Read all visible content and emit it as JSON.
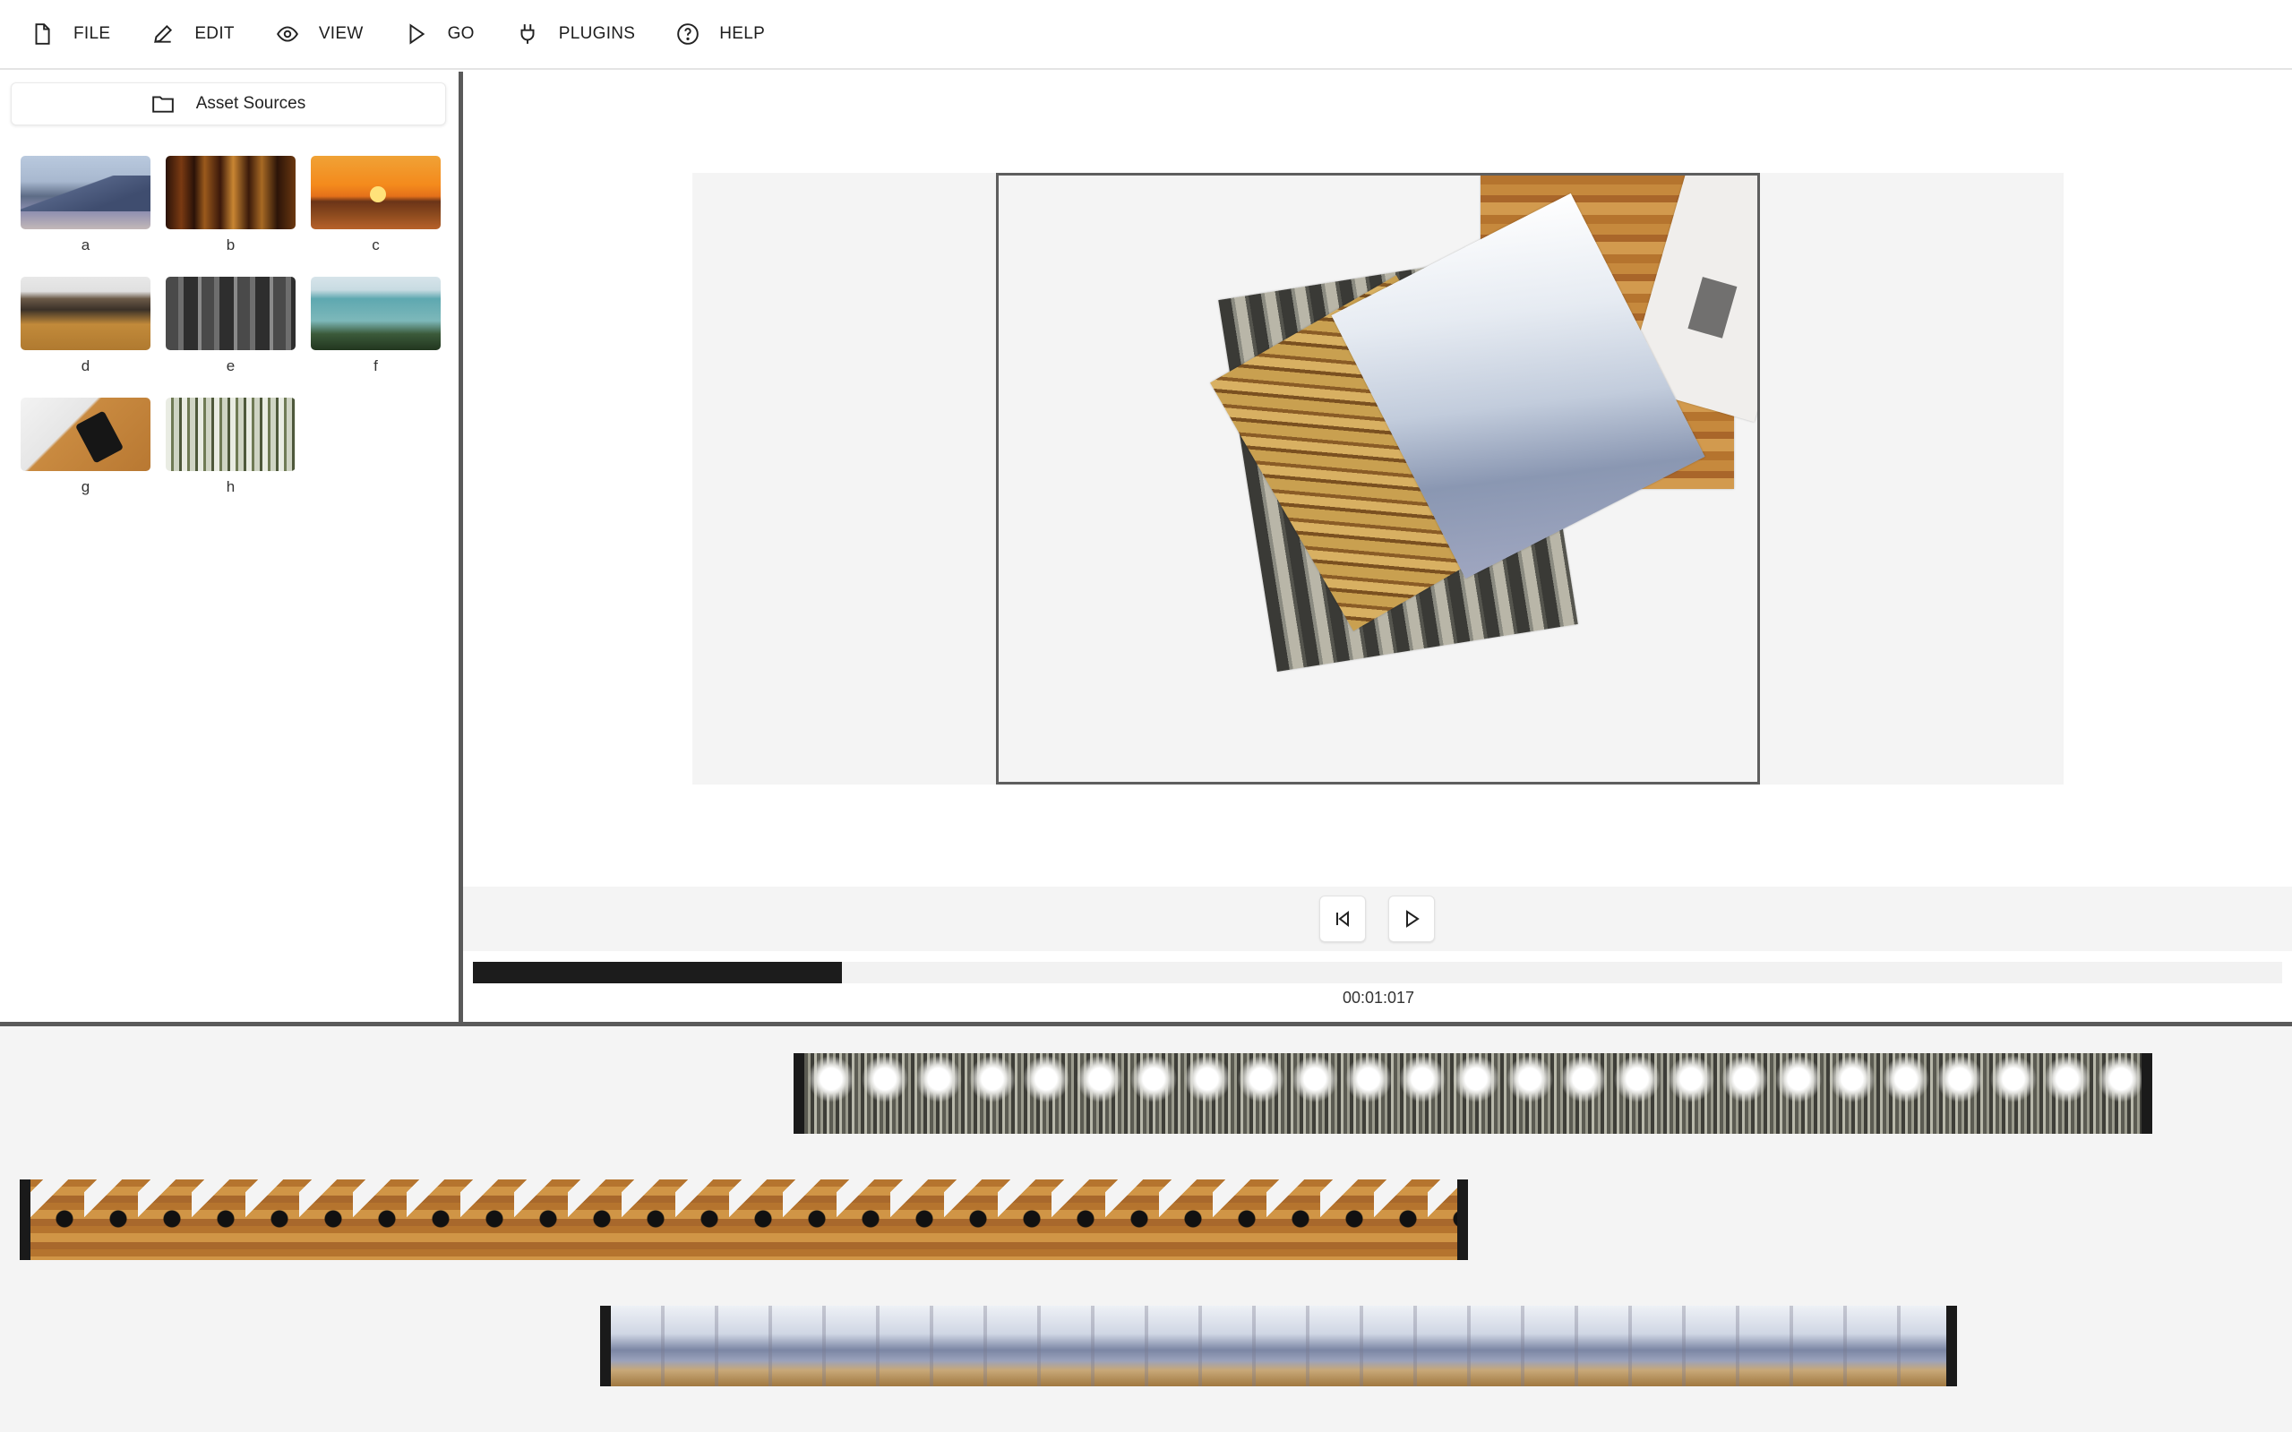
{
  "menu": [
    {
      "label": "FILE",
      "icon": "file-icon"
    },
    {
      "label": "EDIT",
      "icon": "pencil-icon"
    },
    {
      "label": "VIEW",
      "icon": "eye-icon"
    },
    {
      "label": "GO",
      "icon": "play-icon"
    },
    {
      "label": "PLUGINS",
      "icon": "plug-icon"
    },
    {
      "label": "HELP",
      "icon": "help-circle-icon"
    }
  ],
  "sidebar": {
    "asset_sources_label": "Asset Sources",
    "assets": [
      {
        "label": "a",
        "thumb": "mountains"
      },
      {
        "label": "b",
        "thumb": "columns"
      },
      {
        "label": "c",
        "thumb": "sunset"
      },
      {
        "label": "d",
        "thumb": "person-hood"
      },
      {
        "label": "e",
        "thumb": "traffic"
      },
      {
        "label": "f",
        "thumb": "lake"
      },
      {
        "label": "g",
        "thumb": "desk-phone"
      },
      {
        "label": "h",
        "thumb": "buildings"
      }
    ]
  },
  "player": {
    "timecode": "00:01:017",
    "progress_fraction": 0.204
  },
  "timeline": {
    "clips": [
      {
        "thumb": "buildings"
      },
      {
        "thumb": "desk-phone"
      },
      {
        "thumb": "mountains"
      }
    ]
  },
  "colors": {
    "divider": "#5a5a5a",
    "progress_fill": "#1c1c1c",
    "stage_bg": "#f4f4f4"
  }
}
